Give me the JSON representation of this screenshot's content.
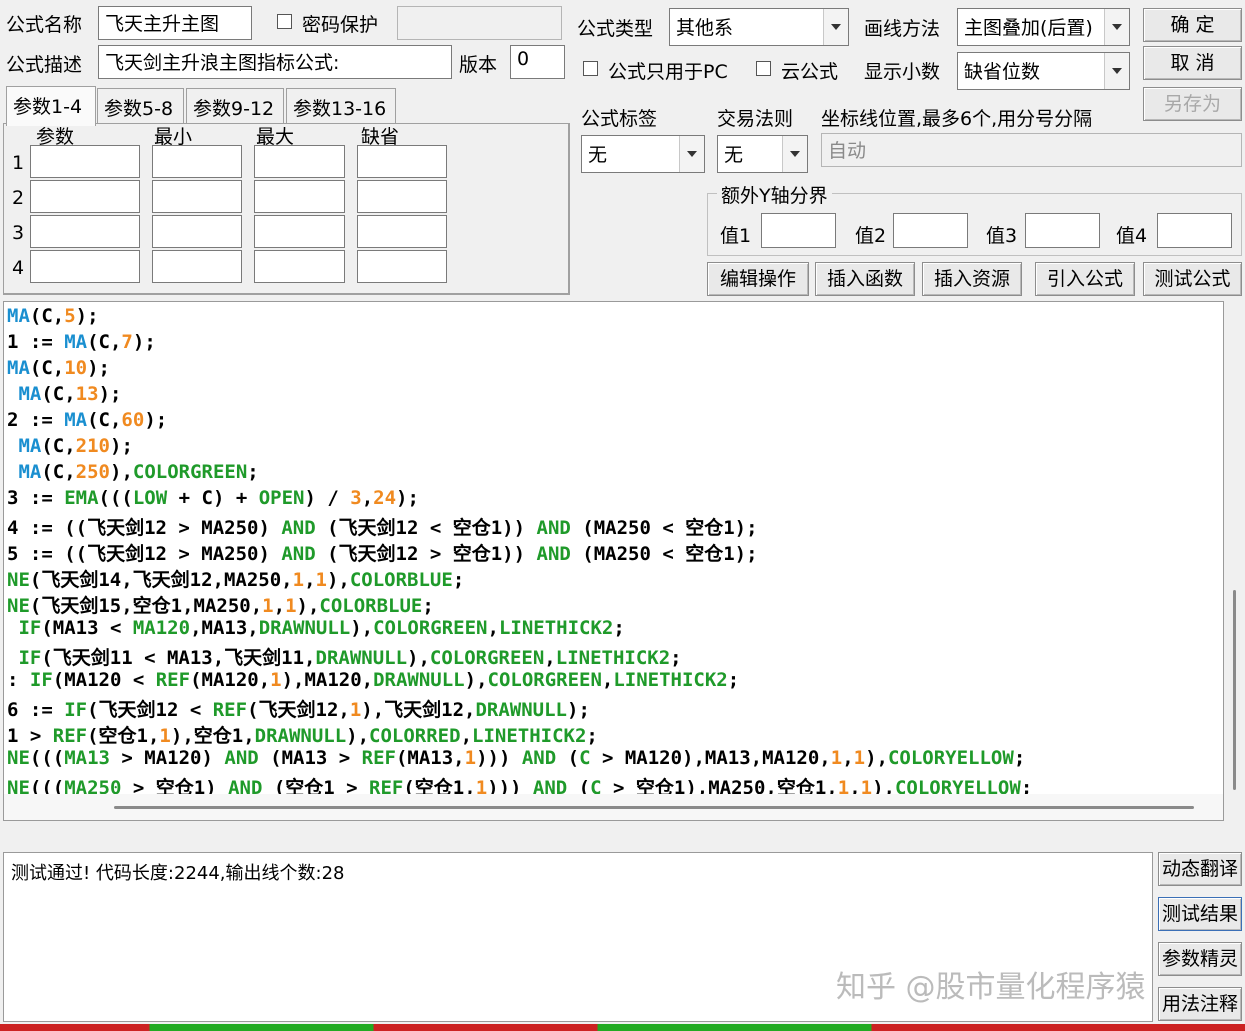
{
  "form": {
    "name_label": "公式名称",
    "name_value": "飞天主升主图",
    "password_label": "密码保护",
    "password_value": "",
    "desc_label": "公式描述",
    "desc_value": "飞天剑主升浪主图指标公式:",
    "version_label": "版本",
    "version_value": "0",
    "type_label": "公式类型",
    "type_value": "其他系",
    "draw_label": "画线方法",
    "draw_value": "主图叠加(后置)",
    "pc_only_label": "公式只用于PC",
    "cloud_label": "云公式",
    "decimals_label": "显示小数",
    "decimals_value": "缺省位数",
    "tag_label": "公式标签",
    "tag_value": "无",
    "rule_label": "交易法则",
    "rule_value": "无",
    "coord_label": "坐标线位置,最多6个,用分号分隔",
    "coord_value": "自动",
    "yaxis_label": "额外Y轴分界",
    "val1_label": "值1",
    "val2_label": "值2",
    "val3_label": "值3",
    "val4_label": "值4"
  },
  "buttons": {
    "ok": "确 定",
    "cancel": "取 消",
    "save_as": "另存为",
    "edit_ops": "编辑操作",
    "insert_func": "插入函数",
    "insert_res": "插入资源",
    "import_formula": "引入公式",
    "test_formula": "测试公式",
    "dynamic_translate": "动态翻译",
    "test_result": "测试结果",
    "param_wizard": "参数精灵",
    "usage_notes": "用法注释"
  },
  "tabs": [
    "参数1-4",
    "参数5-8",
    "参数9-12",
    "参数13-16"
  ],
  "params": {
    "headers": [
      "参数",
      "最小",
      "最大",
      "缺省"
    ],
    "rows": [
      "1",
      "2",
      "3",
      "4"
    ]
  },
  "code_lines": [
    [
      [
        "f",
        "MA"
      ],
      [
        "p",
        "(C,"
      ],
      [
        "n",
        "5"
      ],
      [
        "p",
        ");"
      ]
    ],
    [
      [
        "p",
        "1 := "
      ],
      [
        "f",
        "MA"
      ],
      [
        "p",
        "(C,"
      ],
      [
        "n",
        "7"
      ],
      [
        "p",
        ");"
      ]
    ],
    [
      [
        "f",
        "MA"
      ],
      [
        "p",
        "(C,"
      ],
      [
        "n",
        "10"
      ],
      [
        "p",
        ");"
      ]
    ],
    [
      [
        "p",
        " "
      ],
      [
        "f",
        "MA"
      ],
      [
        "p",
        "(C,"
      ],
      [
        "n",
        "13"
      ],
      [
        "p",
        ");"
      ]
    ],
    [
      [
        "p",
        "2 := "
      ],
      [
        "f",
        "MA"
      ],
      [
        "p",
        "(C,"
      ],
      [
        "n",
        "60"
      ],
      [
        "p",
        ");"
      ]
    ],
    [
      [
        "p",
        " "
      ],
      [
        "f",
        "MA"
      ],
      [
        "p",
        "(C,"
      ],
      [
        "n",
        "210"
      ],
      [
        "p",
        ");"
      ]
    ],
    [
      [
        "p",
        " "
      ],
      [
        "f",
        "MA"
      ],
      [
        "p",
        "(C,"
      ],
      [
        "n",
        "250"
      ],
      [
        "p",
        "),"
      ],
      [
        "k",
        "COLORGREEN"
      ],
      [
        "p",
        ";"
      ]
    ],
    [
      [
        "p",
        "3 := "
      ],
      [
        "k",
        "EMA"
      ],
      [
        "p",
        "((("
      ],
      [
        "k",
        "LOW"
      ],
      [
        "p",
        " + C) + "
      ],
      [
        "k",
        "OPEN"
      ],
      [
        "p",
        ") / "
      ],
      [
        "n",
        "3"
      ],
      [
        "p",
        ","
      ],
      [
        "n",
        "24"
      ],
      [
        "p",
        ");"
      ]
    ],
    [
      [
        "p",
        "4 := ((飞天剑12 > MA250) "
      ],
      [
        "k",
        "AND"
      ],
      [
        "p",
        " (飞天剑12 < 空仓1)) "
      ],
      [
        "k",
        "AND"
      ],
      [
        "p",
        " (MA250 < 空仓1);"
      ]
    ],
    [
      [
        "p",
        "5 := ((飞天剑12 > MA250) "
      ],
      [
        "k",
        "AND"
      ],
      [
        "p",
        " (飞天剑12 > 空仓1)) "
      ],
      [
        "k",
        "AND"
      ],
      [
        "p",
        " (MA250 < 空仓1);"
      ]
    ],
    [
      [
        "k",
        "NE"
      ],
      [
        "p",
        "(飞天剑14,飞天剑12,MA250,"
      ],
      [
        "n",
        "1"
      ],
      [
        "p",
        ","
      ],
      [
        "n",
        "1"
      ],
      [
        "p",
        "),"
      ],
      [
        "k",
        "COLORBLUE"
      ],
      [
        "p",
        ";"
      ]
    ],
    [
      [
        "k",
        "NE"
      ],
      [
        "p",
        "(飞天剑15,空仓1,MA250,"
      ],
      [
        "n",
        "1"
      ],
      [
        "p",
        ","
      ],
      [
        "n",
        "1"
      ],
      [
        "p",
        "),"
      ],
      [
        "k",
        "COLORBLUE"
      ],
      [
        "p",
        ";"
      ]
    ],
    [
      [
        "p",
        " "
      ],
      [
        "k",
        "IF"
      ],
      [
        "p",
        "(MA13 < "
      ],
      [
        "k",
        "MA120"
      ],
      [
        "p",
        ",MA13,"
      ],
      [
        "k",
        "DRAWNULL"
      ],
      [
        "p",
        "),"
      ],
      [
        "k",
        "COLORGREEN"
      ],
      [
        "p",
        ","
      ],
      [
        "k",
        "LINETHICK2"
      ],
      [
        "p",
        ";"
      ]
    ],
    [
      [
        "p",
        " "
      ],
      [
        "k",
        "IF"
      ],
      [
        "p",
        "(飞天剑11 < MA13,飞天剑11,"
      ],
      [
        "k",
        "DRAWNULL"
      ],
      [
        "p",
        "),"
      ],
      [
        "k",
        "COLORGREEN"
      ],
      [
        "p",
        ","
      ],
      [
        "k",
        "LINETHICK2"
      ],
      [
        "p",
        ";"
      ]
    ],
    [
      [
        "p",
        ": "
      ],
      [
        "k",
        "IF"
      ],
      [
        "p",
        "(MA120 < "
      ],
      [
        "k",
        "REF"
      ],
      [
        "p",
        "(MA120,"
      ],
      [
        "n",
        "1"
      ],
      [
        "p",
        "),MA120,"
      ],
      [
        "k",
        "DRAWNULL"
      ],
      [
        "p",
        "),"
      ],
      [
        "k",
        "COLORGREEN"
      ],
      [
        "p",
        ","
      ],
      [
        "k",
        "LINETHICK2"
      ],
      [
        "p",
        ";"
      ]
    ],
    [
      [
        "p",
        "6 := "
      ],
      [
        "k",
        "IF"
      ],
      [
        "p",
        "(飞天剑12 < "
      ],
      [
        "k",
        "REF"
      ],
      [
        "p",
        "(飞天剑12,"
      ],
      [
        "n",
        "1"
      ],
      [
        "p",
        "),飞天剑12,"
      ],
      [
        "k",
        "DRAWNULL"
      ],
      [
        "p",
        ");"
      ]
    ],
    [
      [
        "p",
        "1 > "
      ],
      [
        "k",
        "REF"
      ],
      [
        "p",
        "(空仓1,"
      ],
      [
        "n",
        "1"
      ],
      [
        "p",
        "),空仓1,"
      ],
      [
        "k",
        "DRAWNULL"
      ],
      [
        "p",
        "),"
      ],
      [
        "k",
        "COLORRED"
      ],
      [
        "p",
        ","
      ],
      [
        "k",
        "LINETHICK2"
      ],
      [
        "p",
        ";"
      ]
    ],
    [
      [
        "k",
        "NE"
      ],
      [
        "p",
        "((("
      ],
      [
        "k",
        "MA13"
      ],
      [
        "p",
        " > MA120) "
      ],
      [
        "k",
        "AND"
      ],
      [
        "p",
        " (MA13 > "
      ],
      [
        "k",
        "REF"
      ],
      [
        "p",
        "(MA13,"
      ],
      [
        "n",
        "1"
      ],
      [
        "p",
        "))) "
      ],
      [
        "k",
        "AND"
      ],
      [
        "p",
        " ("
      ],
      [
        "k",
        "C"
      ],
      [
        "p",
        " > MA120),MA13,MA120,"
      ],
      [
        "n",
        "1"
      ],
      [
        "p",
        ","
      ],
      [
        "n",
        "1"
      ],
      [
        "p",
        "),"
      ],
      [
        "k",
        "COLORYELLOW"
      ],
      [
        "p",
        ";"
      ]
    ],
    [
      [
        "k",
        "NE"
      ],
      [
        "p",
        "((("
      ],
      [
        "k",
        "MA250"
      ],
      [
        "p",
        " > 空仓1) "
      ],
      [
        "k",
        "AND"
      ],
      [
        "p",
        " (空仓1 > "
      ],
      [
        "k",
        "REF"
      ],
      [
        "p",
        "(空仓1,"
      ],
      [
        "n",
        "1"
      ],
      [
        "p",
        "))) "
      ],
      [
        "k",
        "AND"
      ],
      [
        "p",
        " ("
      ],
      [
        "k",
        "C"
      ],
      [
        "p",
        " > 空仓1),MA250,空仓1,"
      ],
      [
        "n",
        "1"
      ],
      [
        "p",
        ","
      ],
      [
        "n",
        "1"
      ],
      [
        "p",
        "),"
      ],
      [
        "k",
        "COLORYELLOW"
      ],
      [
        "p",
        ";"
      ]
    ]
  ],
  "output": {
    "message": "测试通过! 代码长度:2244,输出线个数:28"
  },
  "watermark": "知乎 @股市量化程序猿",
  "colors": {
    "function": "#1a8fd0",
    "keyword": "#1f9a2a",
    "number": "#f08a20"
  }
}
